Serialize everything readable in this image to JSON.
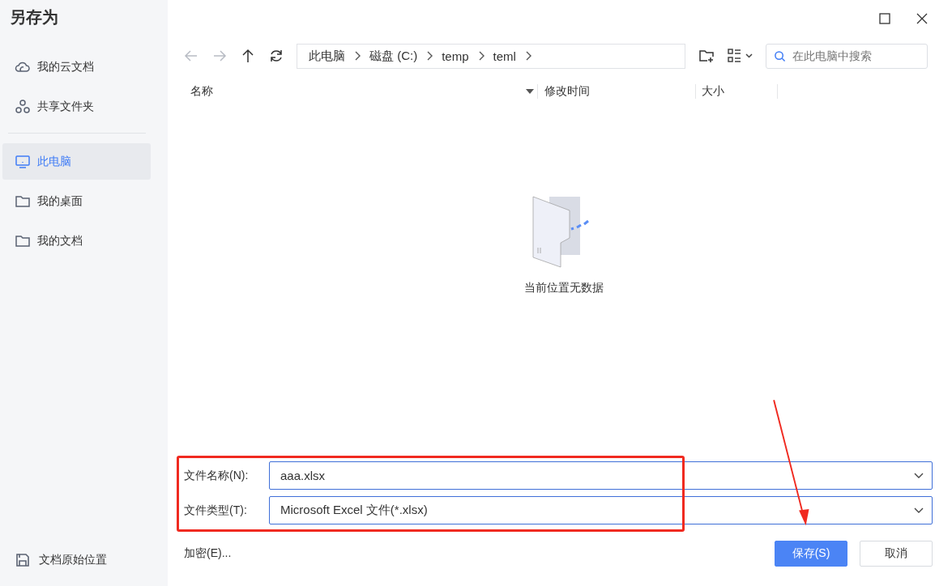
{
  "window": {
    "title": "另存为"
  },
  "sidebar": {
    "items": [
      {
        "label": "我的云文档",
        "kind": "cloud",
        "selected": false
      },
      {
        "label": "共享文件夹",
        "kind": "share",
        "selected": false
      },
      {
        "label": "此电脑",
        "kind": "computer",
        "selected": true
      },
      {
        "label": "我的桌面",
        "kind": "folder",
        "selected": false
      },
      {
        "label": "我的文档",
        "kind": "folder",
        "selected": false
      }
    ],
    "footer": "文档原始位置"
  },
  "nav": {
    "back_disabled": true,
    "forward_disabled": true
  },
  "breadcrumb": [
    "此电脑",
    "磁盘 (C:)",
    "temp",
    "teml"
  ],
  "search": {
    "placeholder": "在此电脑中搜索"
  },
  "columns": [
    "名称",
    "修改时间",
    "大小"
  ],
  "empty_state": {
    "message": "当前位置无数据"
  },
  "fields": [
    {
      "label": "文件名称(N):",
      "value": "aaa.xlsx"
    },
    {
      "label": "文件类型(T):",
      "value": "Microsoft Excel 文件(*.xlsx)"
    }
  ],
  "encrypt_link": "加密(E)...",
  "buttons": [
    {
      "label": "保存(S)",
      "kind": "primary"
    },
    {
      "label": "取消",
      "kind": "secondary"
    }
  ]
}
